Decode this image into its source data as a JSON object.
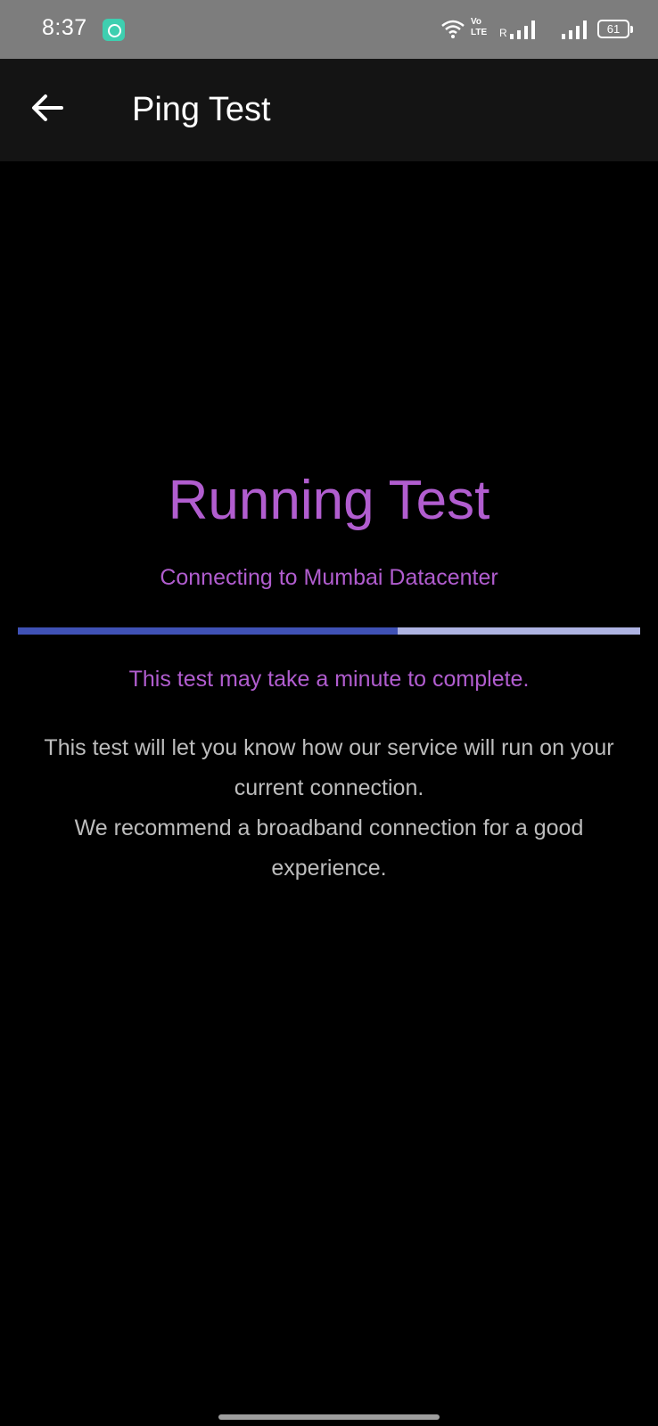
{
  "status_bar": {
    "time": "8:37",
    "app_icon": "app-notification-icon",
    "volte_label": "Vo LTE",
    "roaming_label": "R",
    "battery_level": "61"
  },
  "app_bar": {
    "back_icon": "arrow-back-icon",
    "title": "Ping Test"
  },
  "main": {
    "heading": "Running Test",
    "subheading": "Connecting to Mumbai Datacenter",
    "progress": 0.61,
    "note": "This test may take a minute to complete.",
    "description_line1": "This test will let you know how our service will run on your current connection.",
    "description_line2": "We recommend a broadband connection for a good experience."
  },
  "colors": {
    "accent": "#b15dcf",
    "progress_fill": "#3f51b5",
    "progress_track": "#aeb3e2",
    "status_bar_bg": "#7d7d7d",
    "app_bar_bg": "#141414",
    "background": "#000000"
  }
}
